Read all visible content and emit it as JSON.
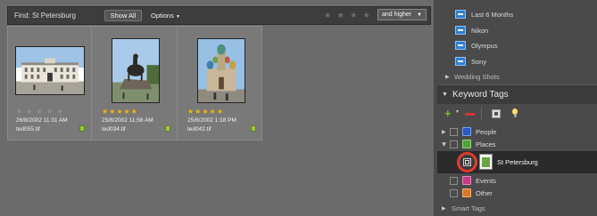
{
  "findbar": {
    "find_label": "Find: St Petersburg",
    "show_all": "Show All",
    "options": "Options",
    "rating_stars": "★ ★ ★ ★ ★",
    "rating_filter": "and higher"
  },
  "photos": [
    {
      "stars": "★ ★ ★ ★ ★",
      "date": "26/8/2002 11:31 AM",
      "file": "ted055.tif",
      "rated": false
    },
    {
      "stars": "★★★★★",
      "date": "25/8/2002 11:56 AM",
      "file": "ted034.tif",
      "rated": true
    },
    {
      "stars": "★★★★★",
      "date": "25/8/2002 1:18 PM",
      "file": "ted042.tif",
      "rated": true
    }
  ],
  "collections": {
    "items": [
      "Last 6 Months",
      "Nikon",
      "Olympus",
      "Sony"
    ],
    "wedding_shots": "Wedding Shots"
  },
  "keyword_tags": {
    "title": "Keyword Tags",
    "people": "People",
    "places": "Places",
    "selected_tag": "St Petersburg",
    "events": "Events",
    "other": "Other",
    "smart_tags": "Smart Tags"
  },
  "colors": {
    "star_active": "#f5b50a",
    "tag_blue": "#2f7fd0",
    "highlight_ring": "#e33b2e",
    "add_green": "#6fbf32",
    "remove_red": "#d63434"
  }
}
